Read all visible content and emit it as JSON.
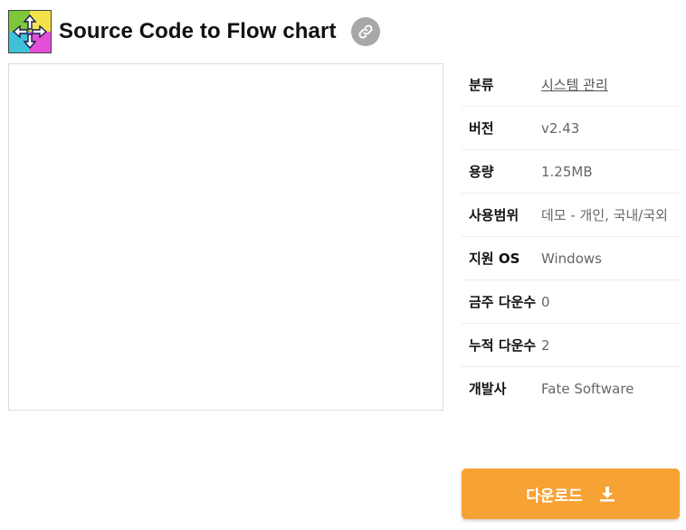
{
  "header": {
    "title": "Source Code to Flow chart",
    "app_icon": "flowchart-app-icon",
    "link_icon": "link-icon"
  },
  "info": {
    "rows": [
      {
        "label": "분류",
        "value": "시스템 관리"
      },
      {
        "label": "버전",
        "value": "v2.43"
      },
      {
        "label": "용량",
        "value": "1.25MB"
      },
      {
        "label": "사용범위",
        "value": "데모 - 개인, 국내/국외"
      },
      {
        "label": "지원 OS",
        "value": "Windows"
      },
      {
        "label": "금주 다운수",
        "value": "0"
      },
      {
        "label": "누적 다운수",
        "value": "2"
      },
      {
        "label": "개발사",
        "value": "Fate Software"
      }
    ]
  },
  "download": {
    "label": "다운로드",
    "icon": "download-icon"
  },
  "colors": {
    "accent": "#f7a234",
    "link_button": "#a8a8a8"
  }
}
